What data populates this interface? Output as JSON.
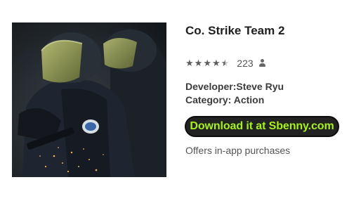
{
  "app": {
    "title": "Co. Strike Team 2",
    "rating": {
      "stars": 4.5,
      "max_stars": 5,
      "count": "223",
      "icon": "person-icon"
    },
    "developer": "Developer:Steve Ryu",
    "category": "Category: Action",
    "download_label": "Download it at Sbenny.com",
    "in_app_note": "Offers in-app purchases",
    "image_icon": "soldiers-artwork"
  },
  "colors": {
    "title": "#1e1e1e",
    "star": "#5e5e5e",
    "download_bg": "#222222",
    "download_text": "#a6f21d"
  }
}
